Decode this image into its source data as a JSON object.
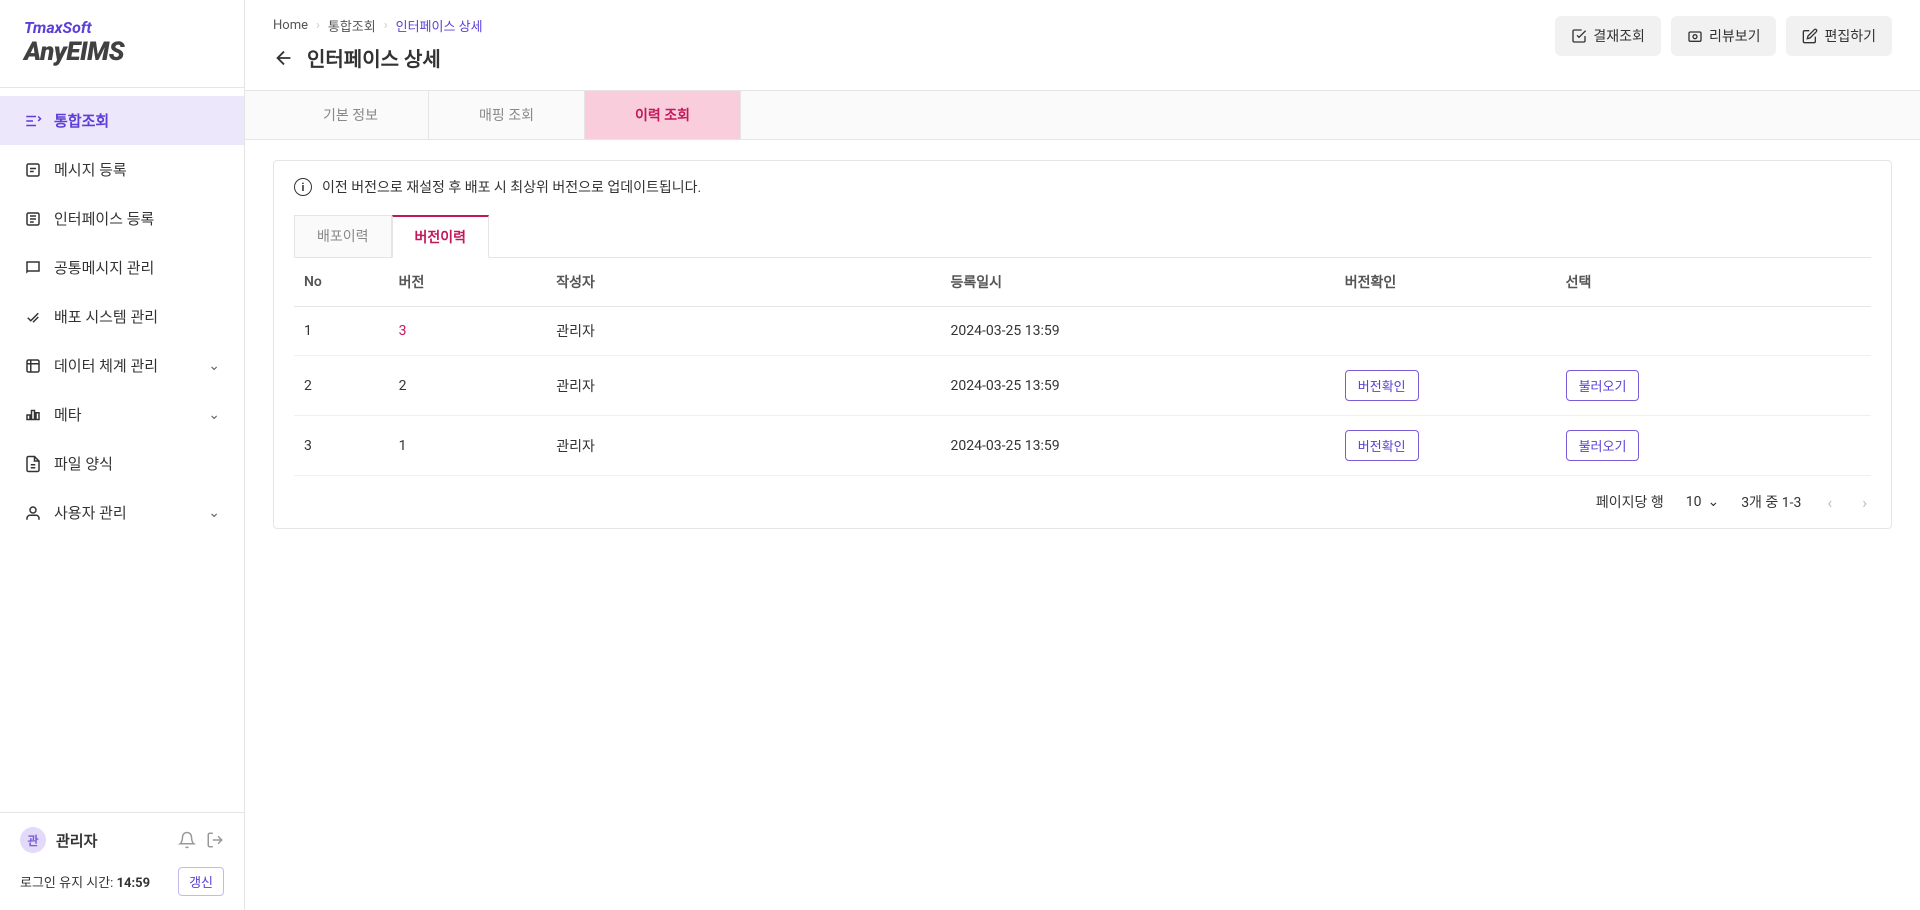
{
  "brand": {
    "company": "TmaxSoft",
    "product": "AnyEIMS"
  },
  "sidebar": {
    "items": [
      {
        "label": "통합조회",
        "active": true,
        "expandable": false
      },
      {
        "label": "메시지 등록",
        "active": false,
        "expandable": false
      },
      {
        "label": "인터페이스 등록",
        "active": false,
        "expandable": false
      },
      {
        "label": "공통메시지 관리",
        "active": false,
        "expandable": false
      },
      {
        "label": "배포 시스템 관리",
        "active": false,
        "expandable": false
      },
      {
        "label": "데이터 체계 관리",
        "active": false,
        "expandable": true
      },
      {
        "label": "메타",
        "active": false,
        "expandable": true
      },
      {
        "label": "파일 양식",
        "active": false,
        "expandable": false
      },
      {
        "label": "사용자 관리",
        "active": false,
        "expandable": true
      }
    ]
  },
  "footer": {
    "avatar_char": "관",
    "user_name": "관리자",
    "session_label": "로그인 유지 시간:",
    "session_time": "14:59",
    "refresh": "갱신"
  },
  "breadcrumb": {
    "home": "Home",
    "parent": "통합조회",
    "current": "인터페이스 상세"
  },
  "page_title": "인터페이스 상세",
  "header_actions": {
    "approval": "결재조회",
    "review": "리뷰보기",
    "edit": "편집하기"
  },
  "main_tabs": [
    {
      "label": "기본 정보",
      "active": false
    },
    {
      "label": "매핑 조회",
      "active": false
    },
    {
      "label": "이력 조회",
      "active": true
    }
  ],
  "info_message": "이전 버전으로 재설정 후 배포 시 최상위 버전으로 업데이트됩니다.",
  "sub_tabs": [
    {
      "label": "배포이력",
      "active": false
    },
    {
      "label": "버전이력",
      "active": true
    }
  ],
  "table": {
    "columns": [
      "No",
      "버전",
      "작성자",
      "등록일시",
      "버전확인",
      "선택"
    ],
    "version_check_label": "버전확인",
    "load_label": "불러오기",
    "rows": [
      {
        "no": "1",
        "version": "3",
        "author": "관리자",
        "date": "2024-03-25 13:59",
        "show_actions": false,
        "accent": true
      },
      {
        "no": "2",
        "version": "2",
        "author": "관리자",
        "date": "2024-03-25 13:59",
        "show_actions": true,
        "accent": false
      },
      {
        "no": "3",
        "version": "1",
        "author": "관리자",
        "date": "2024-03-25 13:59",
        "show_actions": true,
        "accent": false
      }
    ]
  },
  "pagination": {
    "rows_per_page_label": "페이지당 행",
    "rows_per_page_value": "10",
    "range": "3개 중 1-3"
  }
}
